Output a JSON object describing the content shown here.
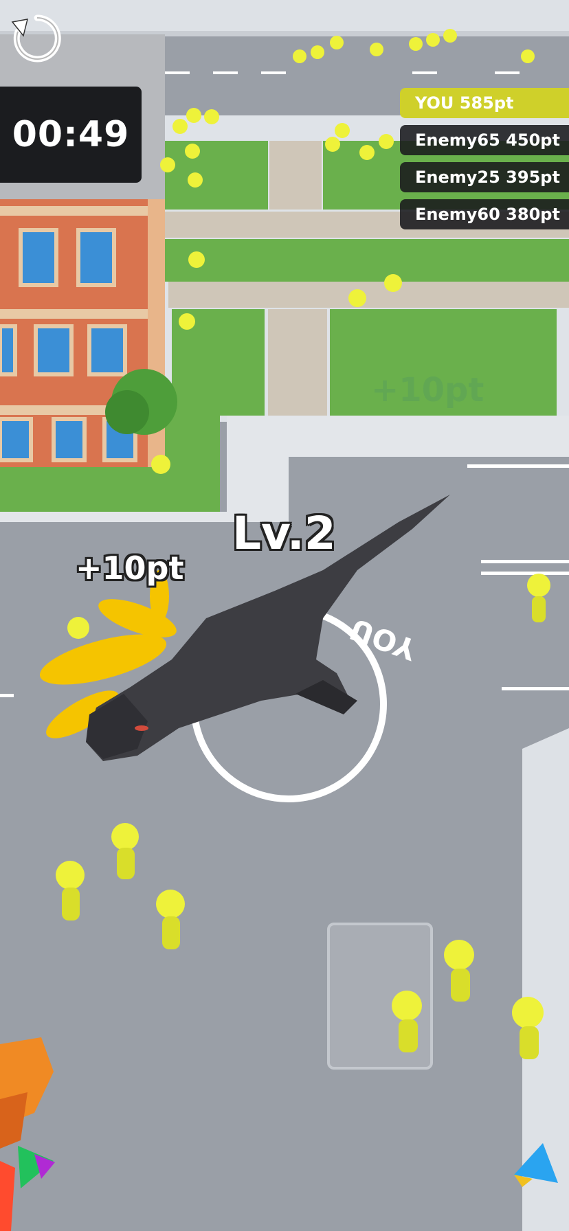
{
  "hud": {
    "timer": "00:49",
    "restart_icon": "restart-icon",
    "level_label": "Lv.2",
    "points_popup": "+10pt",
    "faded_points_popup": "+10pt",
    "you_ring_label": "YOU"
  },
  "leaderboard": [
    {
      "name": "YOU",
      "points": "585pt",
      "is_player": true
    },
    {
      "name": "Enemy65",
      "points": "450pt",
      "is_player": false
    },
    {
      "name": "Enemy25",
      "points": "395pt",
      "is_player": false
    },
    {
      "name": "Enemy60",
      "points": "380pt",
      "is_player": false
    }
  ],
  "colors": {
    "road": "#9a9fa7",
    "grass": "#6ab04c",
    "sidewalk": "#dfe3e8",
    "building_brick": "#d9744f",
    "person_yellow": "#eef23a",
    "dinosaur": "#3d3d42",
    "player_highlight": "#cfd02a",
    "enemy_row": "#19191c"
  }
}
